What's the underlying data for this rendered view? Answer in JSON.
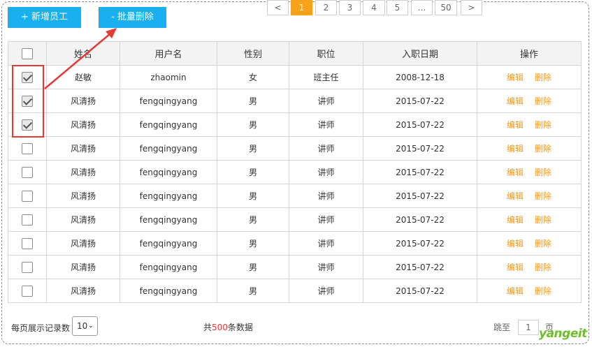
{
  "toolbar": {
    "add_label": "+ 新增员工",
    "batch_delete_label": "- 批量删除"
  },
  "table": {
    "headers": [
      "姓名",
      "用户名",
      "性别",
      "职位",
      "入职日期",
      "操作"
    ],
    "rows": [
      {
        "checked": true,
        "name": "赵敏",
        "username": "zhaomin",
        "gender": "女",
        "position": "班主任",
        "date": "2008-12-18",
        "edit": "编辑",
        "delete": "删除"
      },
      {
        "checked": true,
        "name": "风清扬",
        "username": "fengqingyang",
        "gender": "男",
        "position": "讲师",
        "date": "2015-07-22",
        "edit": "编辑",
        "delete": "删除"
      },
      {
        "checked": true,
        "name": "风清扬",
        "username": "fengqingyang",
        "gender": "男",
        "position": "讲师",
        "date": "2015-07-22",
        "edit": "编辑",
        "delete": "删除"
      },
      {
        "checked": false,
        "name": "风清扬",
        "username": "fengqingyang",
        "gender": "男",
        "position": "讲师",
        "date": "2015-07-22",
        "edit": "编辑",
        "delete": "删除"
      },
      {
        "checked": false,
        "name": "风清扬",
        "username": "fengqingyang",
        "gender": "男",
        "position": "讲师",
        "date": "2015-07-22",
        "edit": "编辑",
        "delete": "删除"
      },
      {
        "checked": false,
        "name": "风清扬",
        "username": "fengqingyang",
        "gender": "男",
        "position": "讲师",
        "date": "2015-07-22",
        "edit": "编辑",
        "delete": "删除"
      },
      {
        "checked": false,
        "name": "风清扬",
        "username": "fengqingyang",
        "gender": "男",
        "position": "讲师",
        "date": "2015-07-22",
        "edit": "编辑",
        "delete": "删除"
      },
      {
        "checked": false,
        "name": "风清扬",
        "username": "fengqingyang",
        "gender": "男",
        "position": "讲师",
        "date": "2015-07-22",
        "edit": "编辑",
        "delete": "删除"
      },
      {
        "checked": false,
        "name": "风清扬",
        "username": "fengqingyang",
        "gender": "男",
        "position": "讲师",
        "date": "2015-07-22",
        "edit": "编辑",
        "delete": "删除"
      },
      {
        "checked": false,
        "name": "风清扬",
        "username": "fengqingyang",
        "gender": "男",
        "position": "讲师",
        "date": "2015-07-22",
        "edit": "编辑",
        "delete": "删除"
      }
    ]
  },
  "footer": {
    "page_size_label": "每页展示记录数",
    "page_size_value": "10",
    "total_prefix": "共",
    "total_count": "500",
    "total_suffix": "条数据",
    "pages": [
      "<",
      "1",
      "2",
      "3",
      "4",
      "5",
      "...",
      "50",
      ">"
    ],
    "active_page": "1",
    "jump_label": "跳至",
    "jump_value": "1",
    "jump_unit": "页"
  },
  "brand": {
    "logo_text": "yangeit"
  },
  "colors": {
    "primary_button": "#1ab0f0",
    "action_link": "#f39a1e",
    "active_page": "#f8a21b",
    "annotation": "#e53935"
  }
}
